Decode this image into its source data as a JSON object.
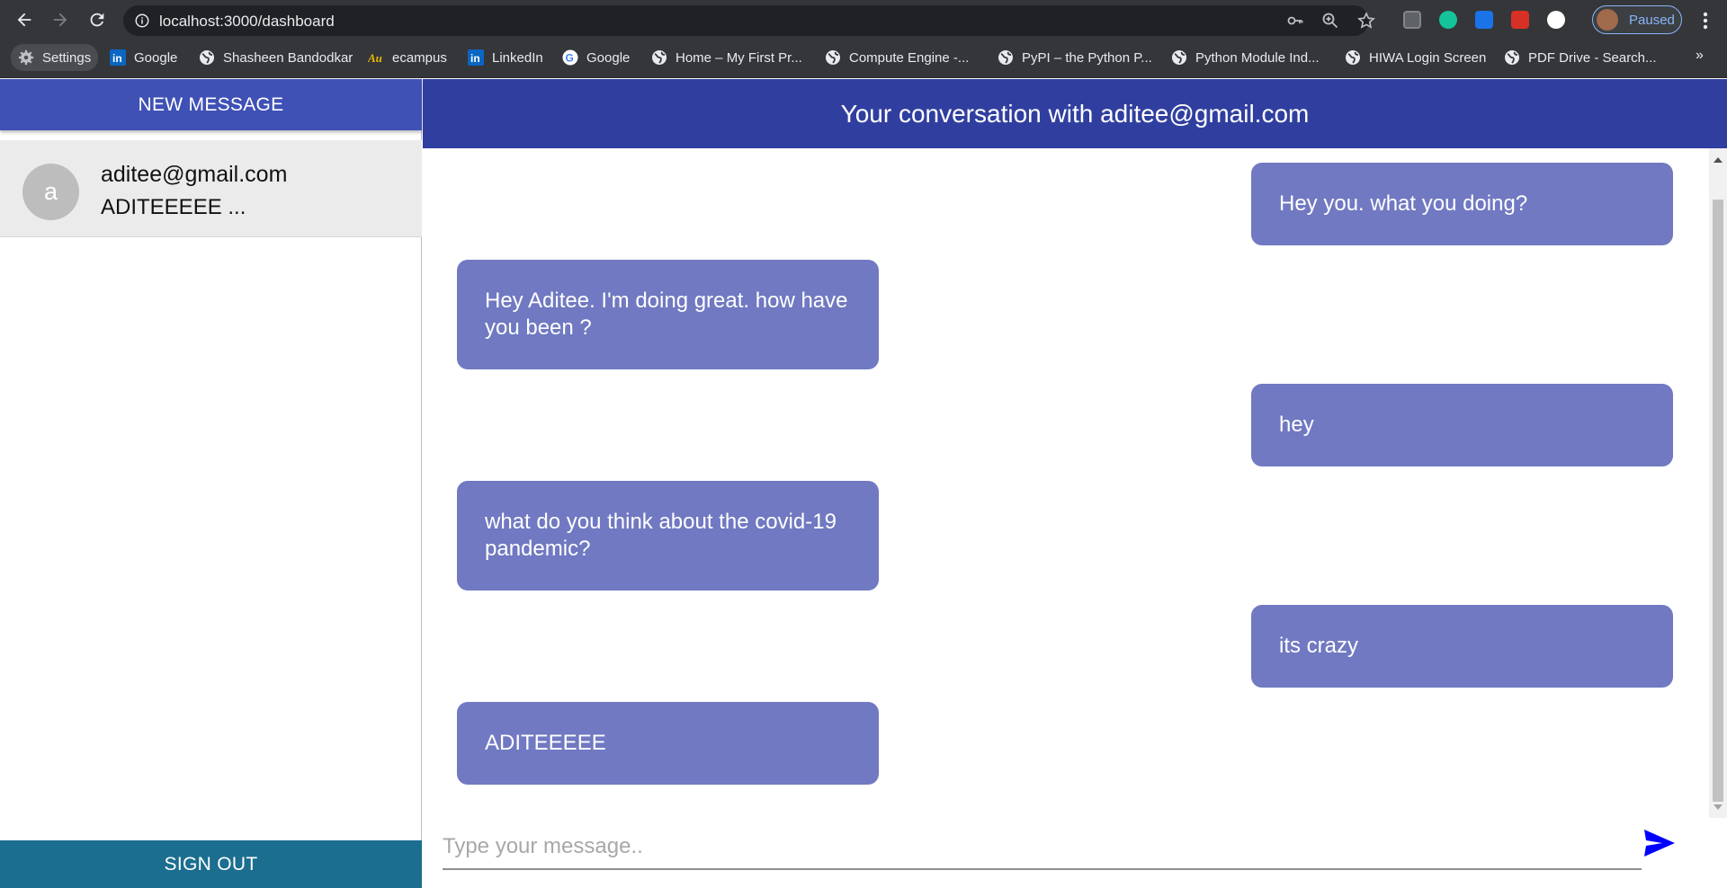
{
  "browser": {
    "url": "localhost:3000/dashboard",
    "profile_label": "Paused",
    "bookmarks": [
      {
        "label": "Settings",
        "icon": "gear-icon"
      },
      {
        "label": "Google",
        "icon": "linkedin-icon"
      },
      {
        "label": "Shasheen Bandodkar",
        "icon": "globe-icon"
      },
      {
        "label": "ecampus",
        "icon": "au-icon"
      },
      {
        "label": "LinkedIn",
        "icon": "linkedin-icon"
      },
      {
        "label": "Google",
        "icon": "google-icon"
      },
      {
        "label": "Home – My First Pr...",
        "icon": "globe-icon"
      },
      {
        "label": "Compute Engine -...",
        "icon": "globe-icon"
      },
      {
        "label": "PyPI – the Python P...",
        "icon": "globe-icon"
      },
      {
        "label": "Python Module Ind...",
        "icon": "globe-icon"
      },
      {
        "label": "HIWA Login Screen",
        "icon": "globe-icon"
      },
      {
        "label": "PDF Drive - Search...",
        "icon": "globe-icon"
      }
    ],
    "overflow": "»"
  },
  "sidebar": {
    "new_message_label": "NEW MESSAGE",
    "chats": [
      {
        "avatar_letter": "a",
        "email": "aditee@gmail.com",
        "preview": "ADITEEEEE ..."
      }
    ],
    "sign_out_label": "SIGN OUT"
  },
  "conversation": {
    "title": "Your conversation with aditee@gmail.com",
    "messages": [
      {
        "from": "me",
        "text": "Hey you. what you doing?"
      },
      {
        "from": "them",
        "text": "Hey Aditee. I'm doing great. how have you been ?"
      },
      {
        "from": "me",
        "text": "hey"
      },
      {
        "from": "them",
        "text": "what do you think about the covid-19 pandemic?"
      },
      {
        "from": "me",
        "text": "its crazy"
      },
      {
        "from": "them",
        "text": "ADITEEEEE"
      }
    ],
    "input_placeholder": "Type your message..",
    "input_value": ""
  },
  "colors": {
    "primary": "#3f51b5",
    "header": "#303f9f",
    "bubble": "#7079c1",
    "sign_out": "#1b6e8f",
    "send_icon": "#0000ff"
  }
}
